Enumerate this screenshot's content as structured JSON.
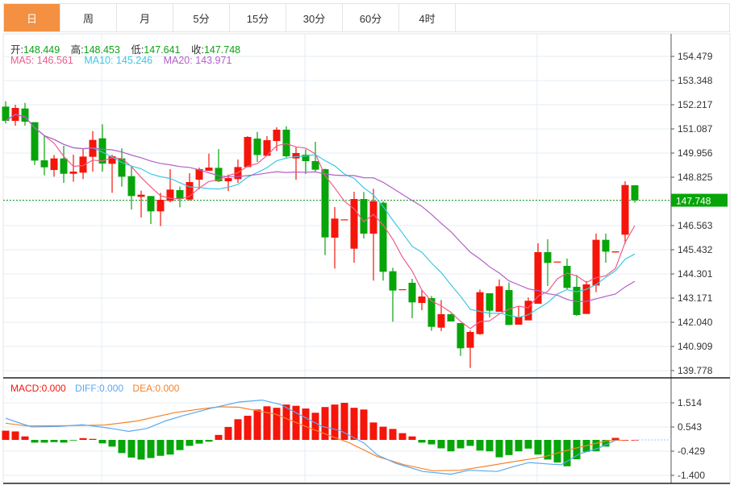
{
  "tabs": [
    "日",
    "周",
    "月",
    "5分",
    "15分",
    "30分",
    "60分",
    "4时"
  ],
  "active_tab": 0,
  "ohlc": {
    "open_label": "开:",
    "open": "148.449",
    "high_label": "高:",
    "high": "148.453",
    "low_label": "低:",
    "low": "147.641",
    "close_label": "收:",
    "close": "147.748"
  },
  "ma": {
    "ma5": "MA5: 146.561",
    "ma10": "MA10: 145.246",
    "ma20": "MA20: 143.971"
  },
  "macd_info": {
    "macd": "MACD:0.000",
    "diff": "DIFF:0.000",
    "dea": "DEA:0.000"
  },
  "colors": {
    "up": "#f5150b",
    "down": "#07a50a",
    "ma5": "#ee5d8a",
    "ma10": "#3cc8e0",
    "ma20": "#b35fc8",
    "diff": "#5aa9f0",
    "dea": "#f7832a",
    "accent": "#f39041"
  },
  "price_axis": [
    "154.479",
    "153.348",
    "152.217",
    "151.087",
    "149.956",
    "148.825",
    "147.695",
    "146.563",
    "145.432",
    "144.301",
    "143.171",
    "142.040",
    "140.909",
    "139.778"
  ],
  "current_price": "147.748",
  "macd_axis": [
    "1.514",
    "0.543",
    "-0.429",
    "-1.400"
  ],
  "candles": [
    [
      152.129,
      152.38,
      151.337,
      151.463
    ],
    [
      151.463,
      152.217,
      151.237,
      152.066
    ],
    [
      152.041,
      152.305,
      151.237,
      151.425
    ],
    [
      151.4,
      151.4,
      149.402,
      149.603
    ],
    [
      149.616,
      150.772,
      148.912,
      149.289
    ],
    [
      149.163,
      149.867,
      148.849,
      149.704
    ],
    [
      149.704,
      150.294,
      148.56,
      148.987
    ],
    [
      148.987,
      149.88,
      148.61,
      149.088
    ],
    [
      149.038,
      150.143,
      148.736,
      149.792
    ],
    [
      149.779,
      150.985,
      149.088,
      150.571
    ],
    [
      150.646,
      151.3,
      149.088,
      149.465
    ],
    [
      149.452,
      149.88,
      148.095,
      149.804
    ],
    [
      149.704,
      150.181,
      148.384,
      148.849
    ],
    [
      148.874,
      149.327,
      147.316,
      147.944
    ],
    [
      147.906,
      148.196,
      146.939,
      148.007
    ],
    [
      147.944,
      147.944,
      146.637,
      147.228
    ],
    [
      147.228,
      148.095,
      146.537,
      147.768
    ],
    [
      147.718,
      149.201,
      147.655,
      148.246
    ],
    [
      148.221,
      148.384,
      147.416,
      147.806
    ],
    [
      147.781,
      149.012,
      147.731,
      148.598
    ],
    [
      148.711,
      149.276,
      148.258,
      149.201
    ],
    [
      149.126,
      149.93,
      149.126,
      149.276
    ],
    [
      149.264,
      150.143,
      148.598,
      148.635
    ],
    [
      148.635,
      148.95,
      148.183,
      148.786
    ],
    [
      148.736,
      149.653,
      148.56,
      149.301
    ],
    [
      149.301,
      150.747,
      149.301,
      150.709
    ],
    [
      150.634,
      150.948,
      149.54,
      149.867
    ],
    [
      149.829,
      150.747,
      149.829,
      150.558
    ],
    [
      150.52,
      151.161,
      150.055,
      151.048
    ],
    [
      151.048,
      151.212,
      149.704,
      149.804
    ],
    [
      149.704,
      150.231,
      148.711,
      149.955
    ],
    [
      149.88,
      150.131,
      148.975,
      149.578
    ],
    [
      149.578,
      150.483,
      149.075,
      149.176
    ],
    [
      149.201,
      149.226,
      145.179,
      146.009
    ],
    [
      145.996,
      147.429,
      144.551,
      146.889
    ],
    [
      146.826,
      146.851,
      146.826,
      146.851
    ],
    [
      145.481,
      148.145,
      144.828,
      147.806
    ],
    [
      147.806,
      148.133,
      145.959,
      146.185
    ],
    [
      146.185,
      148.284,
      143.986,
      147.705
    ],
    [
      147.63,
      147.693,
      143.986,
      144.4
    ],
    [
      144.425,
      144.589,
      142.063,
      143.521
    ],
    [
      143.558,
      143.584,
      143.558,
      143.584
    ],
    [
      143.885,
      144.074,
      142.226,
      142.968
    ],
    [
      142.943,
      143.558,
      142.603,
      143.244
    ],
    [
      143.169,
      143.269,
      141.636,
      141.824
    ],
    [
      141.786,
      143.081,
      141.623,
      142.415
    ],
    [
      142.415,
      142.44,
      142.076,
      142.076
    ],
    [
      142.0,
      142.0,
      140.467,
      140.819
    ],
    [
      140.844,
      141.661,
      139.901,
      141.586
    ],
    [
      141.485,
      143.571,
      141.447,
      143.445
    ],
    [
      143.395,
      143.395,
      142.264,
      142.578
    ],
    [
      142.528,
      144.036,
      142.528,
      143.722
    ],
    [
      143.546,
      143.898,
      141.912,
      141.912
    ],
    [
      141.925,
      142.792,
      141.925,
      142.302
    ],
    [
      142.126,
      143.194,
      142.126,
      143.043
    ],
    [
      142.905,
      145.733,
      142.905,
      145.318
    ],
    [
      145.318,
      145.921,
      143.734,
      144.815
    ],
    [
      144.84,
      144.878,
      144.84,
      144.878
    ],
    [
      144.677,
      145.016,
      143.571,
      143.646
    ],
    [
      143.697,
      144.25,
      142.339,
      142.377
    ],
    [
      142.427,
      143.973,
      142.427,
      143.81
    ],
    [
      143.76,
      146.185,
      143.445,
      145.896
    ],
    [
      145.896,
      146.185,
      144.828,
      145.343
    ],
    [
      145.305,
      145.356,
      145.305,
      145.356
    ],
    [
      146.135,
      148.635,
      145.707,
      148.459
    ],
    [
      148.449,
      148.453,
      147.641,
      147.748
    ]
  ],
  "macd_hist": [
    0.37,
    0.34,
    0.14,
    -0.11,
    -0.11,
    -0.09,
    -0.11,
    -0.02,
    0.07,
    0.04,
    -0.14,
    -0.27,
    -0.53,
    -0.71,
    -0.79,
    -0.73,
    -0.64,
    -0.59,
    -0.41,
    -0.24,
    -0.15,
    -0.07,
    0.2,
    0.52,
    0.83,
    0.97,
    1.22,
    1.35,
    1.29,
    1.42,
    1.37,
    1.26,
    1.09,
    1.32,
    1.42,
    1.49,
    1.29,
    1.22,
    0.7,
    0.53,
    0.44,
    0.27,
    0.14,
    -0.11,
    -0.18,
    -0.34,
    -0.46,
    -0.34,
    -0.24,
    -0.43,
    -0.46,
    -0.7,
    -0.61,
    -0.46,
    -0.35,
    -0.59,
    -0.79,
    -0.91,
    -1.06,
    -0.78,
    -0.48,
    -0.46,
    -0.27,
    0.08,
    0.0,
    0.0
  ],
  "diff_line": [
    [
      0,
      0.87
    ],
    [
      0.8,
      0.76
    ],
    [
      2.7,
      0.52
    ],
    [
      5.5,
      0.54
    ],
    [
      7.9,
      0.61
    ],
    [
      9.8,
      0.52
    ],
    [
      11.7,
      0.41
    ],
    [
      12.7,
      0.34
    ],
    [
      14.6,
      0.46
    ],
    [
      16.5,
      0.76
    ],
    [
      18.4,
      0.98
    ],
    [
      21.2,
      1.27
    ],
    [
      24.1,
      1.52
    ],
    [
      26.5,
      1.6
    ],
    [
      28.4,
      1.42
    ],
    [
      30.3,
      1.03
    ],
    [
      32.7,
      0.54
    ],
    [
      34.6,
      0.37
    ],
    [
      37.0,
      -0.12
    ],
    [
      38.4,
      -0.61
    ],
    [
      40.3,
      -0.94
    ],
    [
      43.1,
      -1.27
    ],
    [
      46.0,
      -1.38
    ],
    [
      47.9,
      -1.22
    ],
    [
      50.8,
      -1.27
    ],
    [
      52.7,
      -1.05
    ],
    [
      54.1,
      -0.91
    ],
    [
      56.5,
      -0.98
    ],
    [
      57.4,
      -1.0
    ],
    [
      59.3,
      -0.56
    ],
    [
      61.2,
      -0.34
    ],
    [
      63.1,
      0.0
    ]
  ],
  "dea_line": [
    [
      0,
      0.67
    ],
    [
      2.2,
      0.56
    ],
    [
      6.5,
      0.57
    ],
    [
      10.3,
      0.6
    ],
    [
      13.6,
      0.76
    ],
    [
      17.4,
      1.09
    ],
    [
      20.3,
      1.25
    ],
    [
      22.2,
      1.33
    ],
    [
      24.1,
      1.31
    ],
    [
      27.9,
      1.03
    ],
    [
      31.7,
      0.43
    ],
    [
      35.5,
      -0.12
    ],
    [
      38.4,
      -0.67
    ],
    [
      41.2,
      -1.0
    ],
    [
      44.1,
      -1.24
    ],
    [
      47.0,
      -1.22
    ],
    [
      49.8,
      -1.05
    ],
    [
      52.2,
      -0.89
    ],
    [
      55.5,
      -0.69
    ],
    [
      58.8,
      -0.34
    ],
    [
      62.2,
      -0.03
    ],
    [
      63.6,
      -0.01
    ]
  ]
}
